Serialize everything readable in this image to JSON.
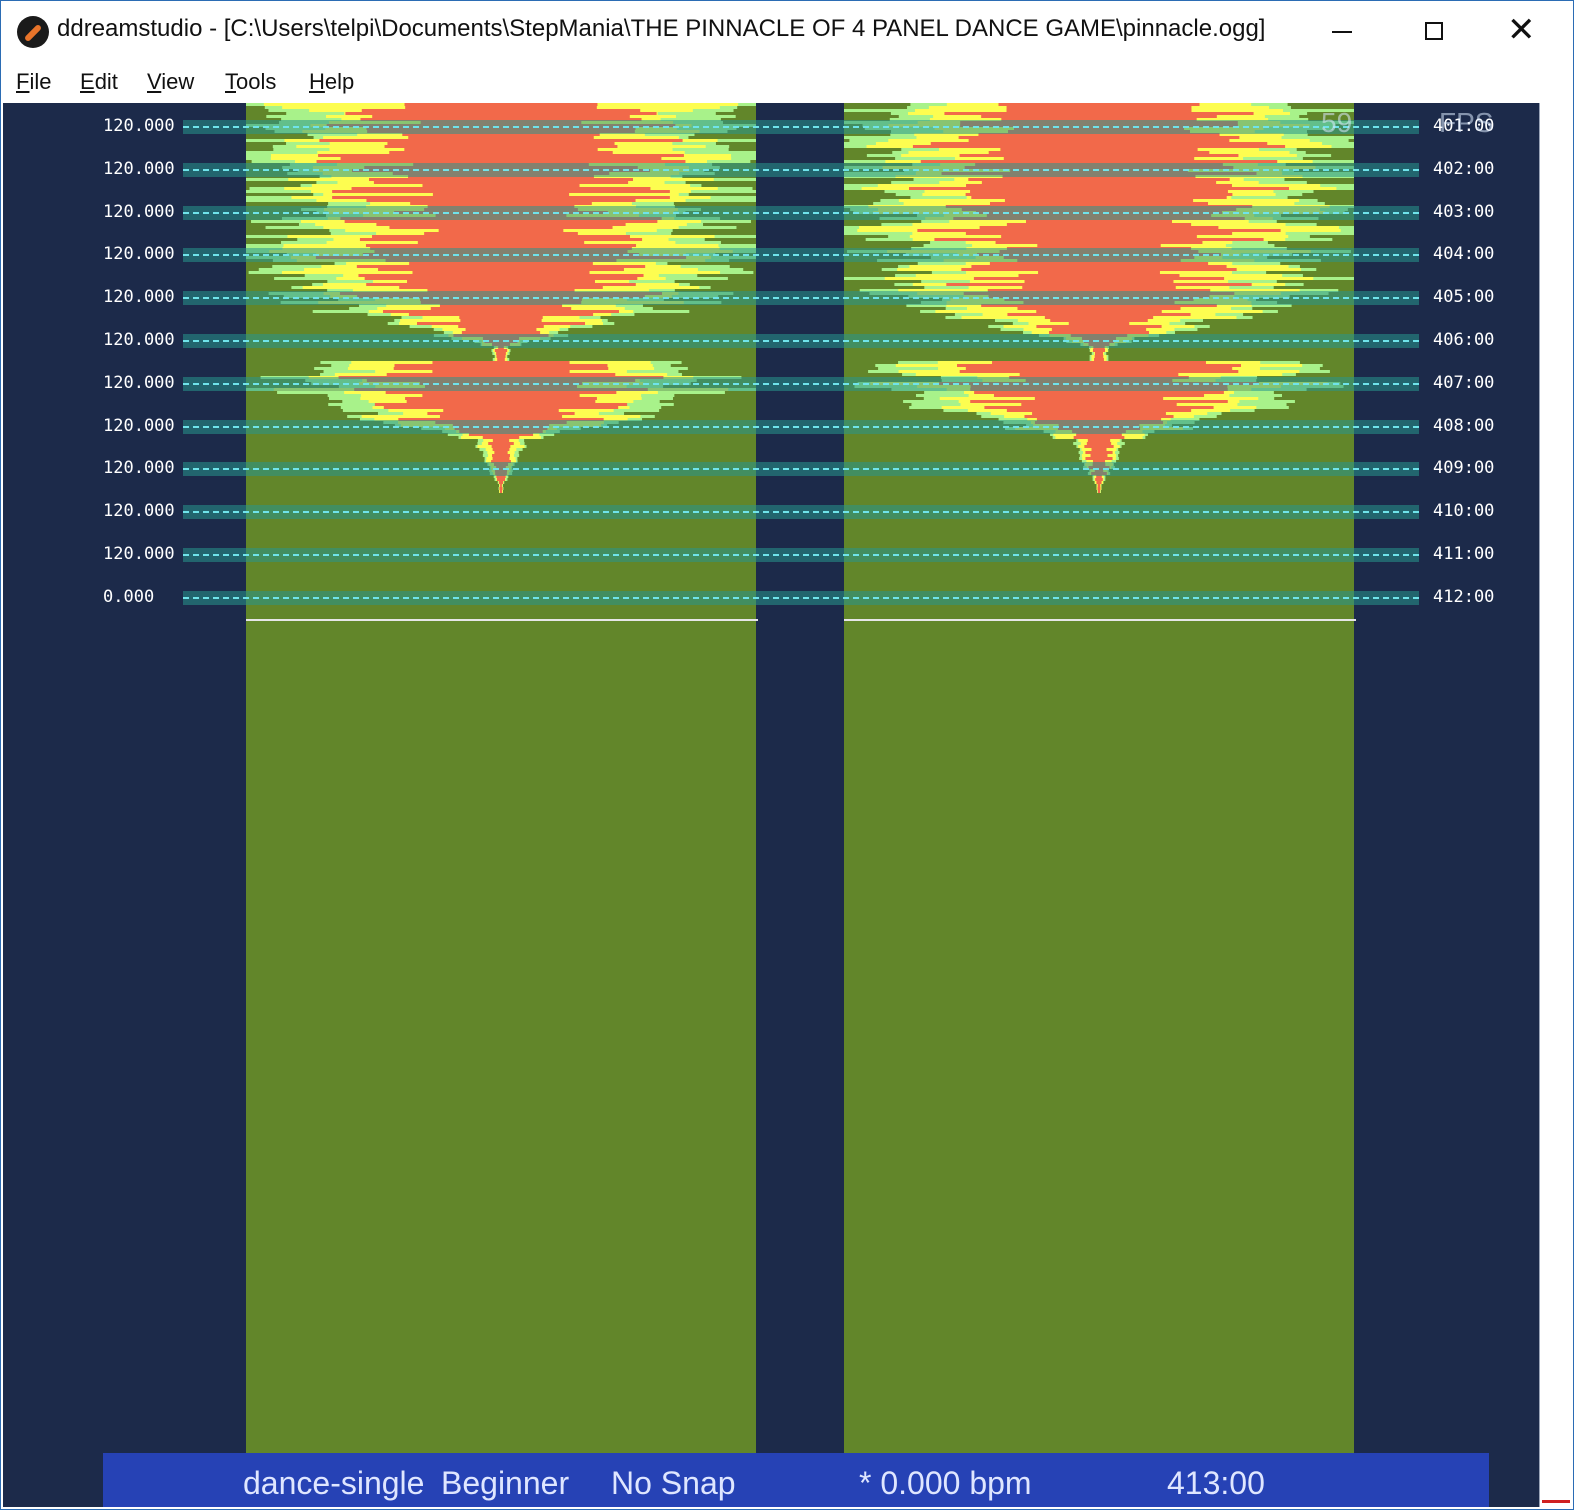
{
  "window": {
    "title": "ddreamstudio - [C:\\Users\\telpi\\Documents\\StepMania\\THE PINNACLE OF 4 PANEL DANCE GAME\\pinnacle.ogg]",
    "minimize_glyph": "",
    "maximize_glyph": "",
    "close_glyph": "✕"
  },
  "menu": {
    "items": [
      {
        "label_first": "F",
        "label_rest": "ile"
      },
      {
        "label_first": "E",
        "label_rest": "dit"
      },
      {
        "label_first": "V",
        "label_rest": "iew"
      },
      {
        "label_first": "T",
        "label_rest": "ools"
      },
      {
        "label_first": "H",
        "label_rest": "elp"
      }
    ]
  },
  "editor": {
    "fps_value": "59",
    "fps_label": "FPS",
    "rows": [
      {
        "bpm": "120.000",
        "time": "401:00"
      },
      {
        "bpm": "120.000",
        "time": "402:00"
      },
      {
        "bpm": "120.000",
        "time": "403:00"
      },
      {
        "bpm": "120.000",
        "time": "404:00"
      },
      {
        "bpm": "120.000",
        "time": "405:00"
      },
      {
        "bpm": "120.000",
        "time": "406:00"
      },
      {
        "bpm": "120.000",
        "time": "407:00"
      },
      {
        "bpm": "120.000",
        "time": "408:00"
      },
      {
        "bpm": "120.000",
        "time": "409:00"
      },
      {
        "bpm": "120.000",
        "time": "410:00"
      },
      {
        "bpm": "120.000",
        "time": "411:00"
      },
      {
        "bpm": "0.000",
        "time": "412:00"
      }
    ],
    "colors": {
      "background": "#1c2a4a",
      "waveform_base": "#62862a",
      "waveform_low": "#fdfd50",
      "waveform_mid": "#a8f28a",
      "waveform_high": "#f2694a"
    }
  },
  "status": {
    "style": "dance-single",
    "difficulty": "Beginner",
    "snap": "No Snap",
    "bpm": "* 0.000 bpm",
    "time": "413:00"
  }
}
